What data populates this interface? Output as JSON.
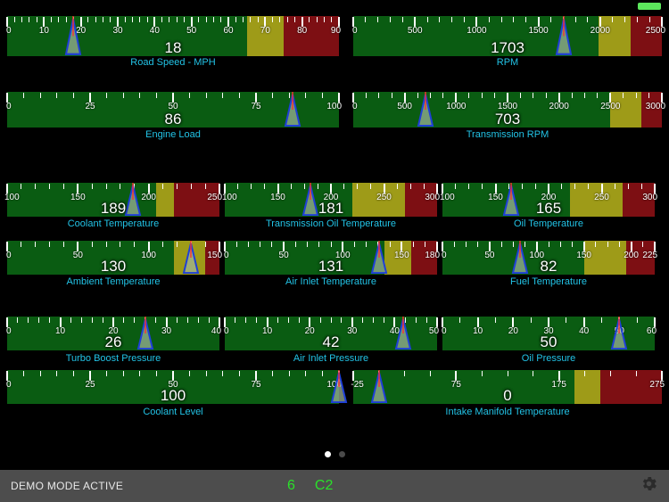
{
  "app": {
    "background": "#000000",
    "accent_caption": "#22c3e6",
    "zone_green": "#0a5c12",
    "zone_yellow": "#9e9b18",
    "zone_red": "#7d0f13",
    "needle_outline": "#1f3fd8",
    "needle_fill": "#9fb49a",
    "needle_hairline": "#ff3030"
  },
  "status_led": {
    "name": "connection-led",
    "color": "#5ce65c"
  },
  "gauges": [
    {
      "id": "road-speed",
      "label": "Road Speed - MPH",
      "value": "18",
      "min": 0,
      "max": 90,
      "ticks": [
        0,
        10,
        20,
        30,
        40,
        50,
        60,
        70,
        80,
        90
      ],
      "minor_step": 2,
      "zones": [
        {
          "color": "green",
          "from": 0,
          "to": 65
        },
        {
          "color": "yellow",
          "from": 65,
          "to": 75
        },
        {
          "color": "red",
          "from": 75,
          "to": 90
        }
      ],
      "needle": 18
    },
    {
      "id": "rpm",
      "label": "RPM",
      "value": "1703",
      "min": 0,
      "max": 2500,
      "ticks": [
        0,
        500,
        1000,
        1500,
        2000,
        2500
      ],
      "minor_step": 100,
      "zones": [
        {
          "color": "green",
          "from": 0,
          "to": 1990
        },
        {
          "color": "yellow",
          "from": 1990,
          "to": 2250
        },
        {
          "color": "red",
          "from": 2250,
          "to": 2500
        }
      ],
      "needle": 1703
    },
    {
      "id": "engine-load",
      "label": "Engine Load",
      "value": "86",
      "min": 0,
      "max": 100,
      "ticks": [
        0,
        25,
        50,
        75,
        100
      ],
      "minor_step": 5,
      "zones": [
        {
          "color": "green",
          "from": 0,
          "to": 100
        }
      ],
      "needle": 86
    },
    {
      "id": "transmission-rpm",
      "label": "Transmission RPM",
      "value": "703",
      "min": 0,
      "max": 3000,
      "ticks": [
        0,
        500,
        1000,
        1500,
        2000,
        2500,
        3000
      ],
      "minor_step": 125,
      "zones": [
        {
          "color": "green",
          "from": 0,
          "to": 2500
        },
        {
          "color": "yellow",
          "from": 2500,
          "to": 2800
        },
        {
          "color": "red",
          "from": 2800,
          "to": 3000
        }
      ],
      "needle": 703
    },
    {
      "id": "coolant-temperature",
      "label": "Coolant Temperature",
      "value": "189",
      "min": 100,
      "max": 250,
      "ticks": [
        100,
        150,
        200,
        250
      ],
      "minor_step": 10,
      "zones": [
        {
          "color": "green",
          "from": 100,
          "to": 205
        },
        {
          "color": "yellow",
          "from": 205,
          "to": 218
        },
        {
          "color": "red",
          "from": 218,
          "to": 250
        }
      ],
      "needle": 189
    },
    {
      "id": "transmission-oil-temperature",
      "label": "Transmission Oil Temperature",
      "value": "181",
      "min": 100,
      "max": 300,
      "ticks": [
        100,
        150,
        200,
        250,
        300
      ],
      "minor_step": 12.5,
      "zones": [
        {
          "color": "green",
          "from": 100,
          "to": 220
        },
        {
          "color": "yellow",
          "from": 220,
          "to": 270
        },
        {
          "color": "red",
          "from": 270,
          "to": 300
        }
      ],
      "needle": 181
    },
    {
      "id": "oil-temperature",
      "label": "Oil Temperature",
      "value": "165",
      "min": 100,
      "max": 300,
      "ticks": [
        100,
        150,
        200,
        250,
        300
      ],
      "minor_step": 12.5,
      "zones": [
        {
          "color": "green",
          "from": 100,
          "to": 220
        },
        {
          "color": "yellow",
          "from": 220,
          "to": 270
        },
        {
          "color": "red",
          "from": 270,
          "to": 300
        }
      ],
      "needle": 165
    },
    {
      "id": "ambient-temperature",
      "label": "Ambient Temperature",
      "value": "130",
      "min": 0,
      "max": 150,
      "ticks": [
        0,
        50,
        100,
        150
      ],
      "minor_step": 10,
      "zones": [
        {
          "color": "green",
          "from": 0,
          "to": 118
        },
        {
          "color": "yellow",
          "from": 118,
          "to": 140
        },
        {
          "color": "red",
          "from": 140,
          "to": 150
        }
      ],
      "needle": 130
    },
    {
      "id": "air-inlet-temperature",
      "label": "Air Inlet Temperature",
      "value": "131",
      "min": 0,
      "max": 180,
      "ticks": [
        0,
        50,
        100,
        150,
        180
      ],
      "minor_step": 10,
      "zones": [
        {
          "color": "green",
          "from": 0,
          "to": 135
        },
        {
          "color": "yellow",
          "from": 135,
          "to": 158
        },
        {
          "color": "red",
          "from": 158,
          "to": 180
        }
      ],
      "needle": 131
    },
    {
      "id": "fuel-temperature",
      "label": "Fuel Temperature",
      "value": "82",
      "min": 0,
      "max": 225,
      "ticks": [
        0,
        50,
        100,
        150,
        200,
        225
      ],
      "minor_step": 12.5,
      "zones": [
        {
          "color": "green",
          "from": 0,
          "to": 150
        },
        {
          "color": "yellow",
          "from": 150,
          "to": 195
        },
        {
          "color": "red",
          "from": 195,
          "to": 225
        }
      ],
      "needle": 82
    },
    {
      "id": "turbo-boost-pressure",
      "label": "Turbo Boost Pressure",
      "value": "26",
      "min": 0,
      "max": 40,
      "ticks": [
        0,
        10,
        20,
        30,
        40
      ],
      "minor_step": 2,
      "zones": [
        {
          "color": "green",
          "from": 0,
          "to": 40
        }
      ],
      "needle": 26
    },
    {
      "id": "air-inlet-pressure",
      "label": "Air Inlet Pressure",
      "value": "42",
      "min": 0,
      "max": 50,
      "ticks": [
        0,
        10,
        20,
        30,
        40,
        50
      ],
      "minor_step": 2.5,
      "zones": [
        {
          "color": "green",
          "from": 0,
          "to": 50
        }
      ],
      "needle": 42
    },
    {
      "id": "oil-pressure",
      "label": "Oil Pressure",
      "value": "50",
      "min": 0,
      "max": 60,
      "ticks": [
        0,
        10,
        20,
        30,
        40,
        50,
        60
      ],
      "minor_step": 5,
      "zones": [
        {
          "color": "green",
          "from": 0,
          "to": 60
        }
      ],
      "needle": 50
    },
    {
      "id": "coolant-level",
      "label": "Coolant Level",
      "value": "100",
      "min": 0,
      "max": 100,
      "ticks": [
        0,
        25,
        50,
        75,
        100
      ],
      "minor_step": 5,
      "zones": [
        {
          "color": "green",
          "from": 0,
          "to": 100
        }
      ],
      "needle": 100
    },
    {
      "id": "intake-manifold-temperature",
      "label": "Intake Manifold Temperature",
      "value": "0",
      "min": -25,
      "max": 275,
      "ticks": [
        -25,
        75,
        175,
        275
      ],
      "minor_step": 25,
      "zones": [
        {
          "color": "green",
          "from": -25,
          "to": 190
        },
        {
          "color": "yellow",
          "from": 190,
          "to": 215
        },
        {
          "color": "red",
          "from": 215,
          "to": 275
        }
      ],
      "needle": 0
    }
  ],
  "page_dots": {
    "count": 2,
    "active_index": 0
  },
  "toolbar": {
    "demo_label": "DEMO MODE ACTIVE",
    "code_1": "6",
    "code_2": "C2",
    "settings_icon": "gear-icon"
  }
}
